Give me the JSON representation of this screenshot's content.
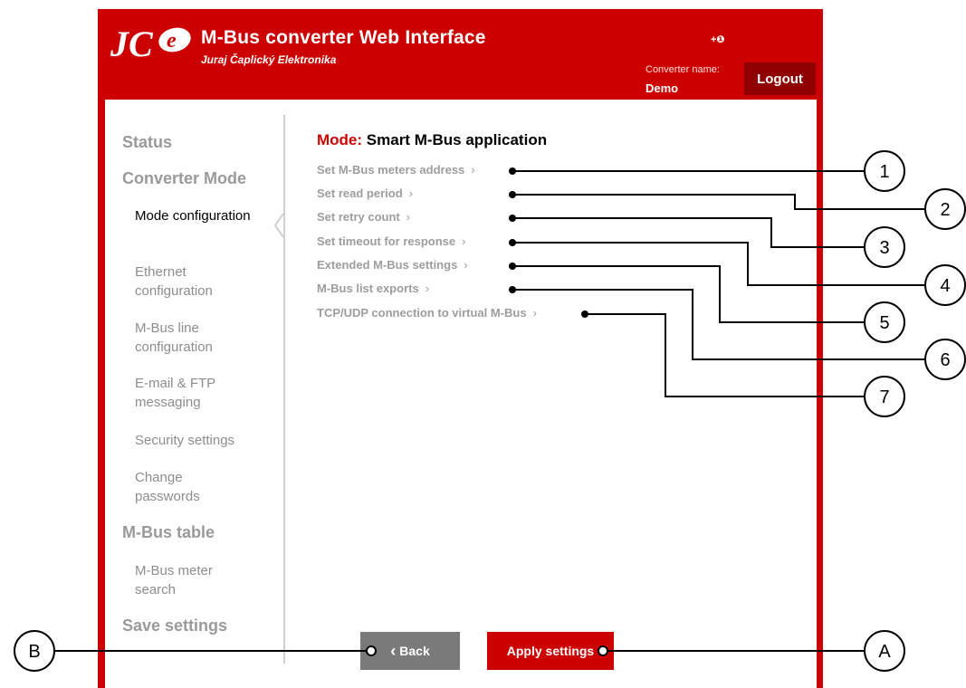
{
  "header": {
    "title": "M-Bus converter Web Interface",
    "subtitle": "Juraj Čaplický Elektronika",
    "logo_text": "JC e",
    "help_icon_label": "+❶",
    "converter_name_label": "Converter name:",
    "converter_name": "Demo",
    "logout_label": "Logout"
  },
  "sidebar": {
    "items": [
      {
        "label": "Status",
        "level": "major"
      },
      {
        "label": "Converter Mode",
        "level": "major"
      },
      {
        "label": "Mode configuration",
        "level": "sub",
        "active": true
      },
      {
        "label": "Ethernet configuration",
        "level": "sub"
      },
      {
        "label": "M-Bus line configuration",
        "level": "sub"
      },
      {
        "label": "E-mail & FTP messaging",
        "level": "sub"
      },
      {
        "label": "Security settings",
        "level": "sub"
      },
      {
        "label": "Change passwords",
        "level": "sub"
      },
      {
        "label": "M-Bus table",
        "level": "major"
      },
      {
        "label": "M-Bus meter search",
        "level": "sub"
      },
      {
        "label": "Save settings",
        "level": "major"
      }
    ]
  },
  "main": {
    "mode_prefix": "Mode:",
    "mode_value": "Smart M-Bus application",
    "links": [
      "Set M-Bus meters address",
      "Set read period",
      "Set retry count",
      "Set timeout for response",
      "Extended M-Bus settings",
      "M-Bus list exports",
      "TCP/UDP connection to virtual M-Bus"
    ],
    "chevron": "›"
  },
  "buttons": {
    "back_label": "Back",
    "back_chevron": "‹",
    "apply_label": "Apply settings"
  },
  "callouts": {
    "numbers": [
      "1",
      "2",
      "3",
      "4",
      "5",
      "6",
      "7"
    ],
    "letters": [
      "A",
      "B"
    ]
  },
  "colors": {
    "brand_red": "#cc0000",
    "dark_red": "#8f0000",
    "muted_gray": "#9d9d9d",
    "back_gray": "#7a7a7a"
  }
}
